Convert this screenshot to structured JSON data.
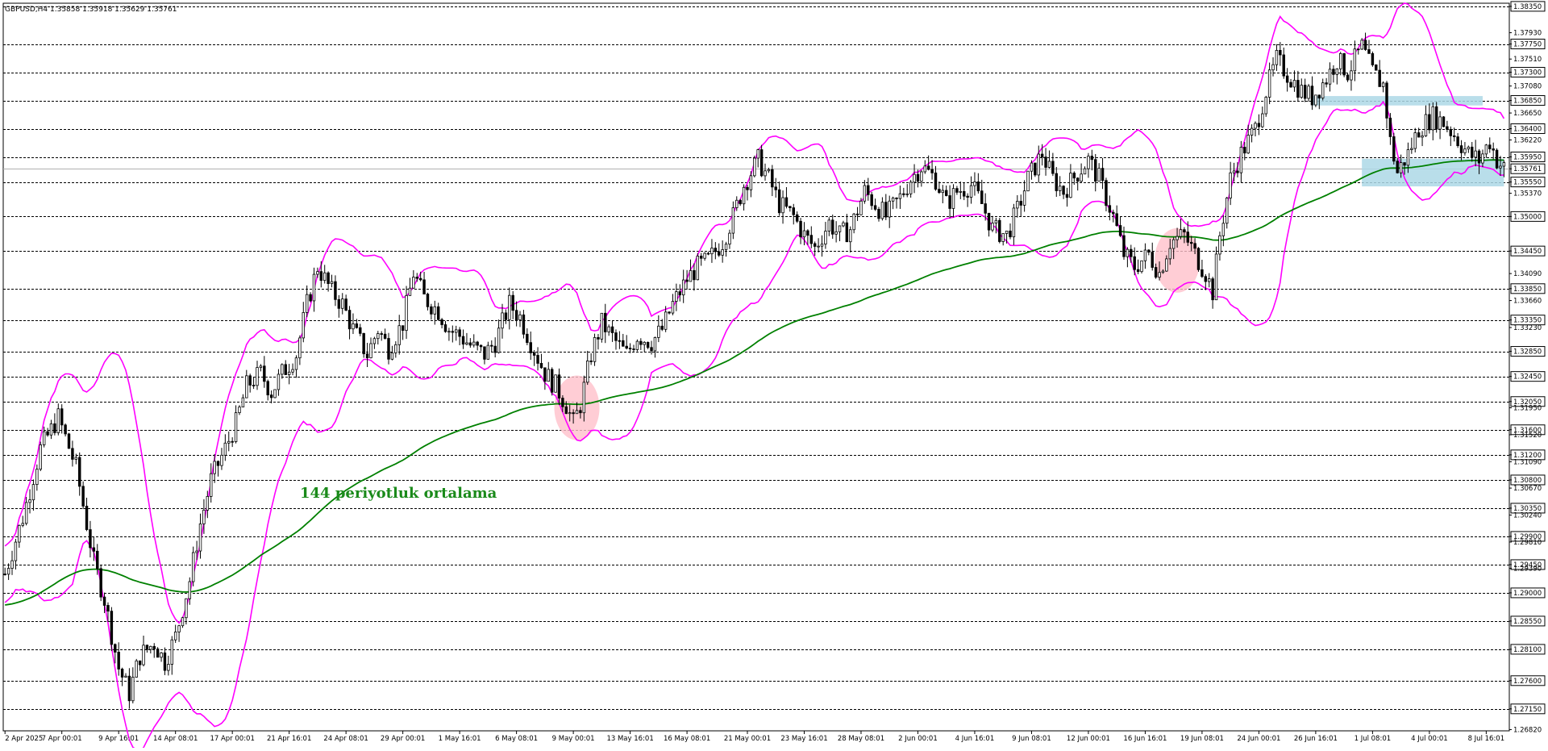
{
  "header": {
    "symbol_line": "GBPUSD,H4  1.35858 1.35918 1.35629 1.35761"
  },
  "annotation": {
    "ma_label": "144 periyotluk ortalama"
  },
  "colors": {
    "candle": "#000000",
    "bollinger": "#ff00ff",
    "moving_average": "#008000",
    "zone_fill": "#add8e6",
    "circle_fill": "#ffc0cb",
    "grid": "#000000"
  },
  "chart_data": {
    "type": "candlestick",
    "title": "GBPUSD,H4",
    "ohlc_header": {
      "open": 1.35858,
      "high": 1.35918,
      "low": 1.35629,
      "close": 1.35761
    },
    "ylim": [
      1.268,
      1.384
    ],
    "x_tick_labels": [
      "2 Apr 2025",
      "7 Apr 00:01",
      "9 Apr 16:01",
      "14 Apr 08:01",
      "17 Apr 00:01",
      "21 Apr 16:01",
      "24 Apr 08:01",
      "29 Apr 00:01",
      "1 May 16:01",
      "6 May 08:01",
      "9 May 00:01",
      "13 May 16:01",
      "16 May 08:01",
      "21 May 00:01",
      "23 May 16:01",
      "28 May 08:01",
      "2 Jun 00:01",
      "4 Jun 16:01",
      "9 Jun 08:01",
      "12 Jun 00:01",
      "16 Jun 16:01",
      "19 Jun 08:01",
      "24 Jun 00:01",
      "26 Jun 16:01",
      "1 Jul 08:01",
      "4 Jul 00:01",
      "8 Jul 16:01"
    ],
    "y_tick_labels": [
      "1.38350",
      "1.37930",
      "1.37750",
      "1.37510",
      "1.37300",
      "1.37080",
      "1.36850",
      "1.36650",
      "1.36400",
      "1.36220",
      "1.35950",
      "1.35761",
      "1.35550",
      "1.35370",
      "1.35000",
      "1.34450",
      "1.34090",
      "1.33850",
      "1.33660",
      "1.33350",
      "1.33230",
      "1.32850",
      "1.32450",
      "1.32050",
      "1.31950",
      "1.31600",
      "1.31520",
      "1.31200",
      "1.31090",
      "1.30800",
      "1.30670",
      "1.30350",
      "1.30240",
      "1.29900",
      "1.29810",
      "1.29450",
      "1.29390",
      "1.29000",
      "1.28550",
      "1.28100",
      "1.27600",
      "1.27150",
      "1.26820"
    ],
    "horizontal_levels": [
      1.3835,
      1.3775,
      1.373,
      1.3685,
      1.364,
      1.3595,
      1.3555,
      1.35,
      1.3445,
      1.3385,
      1.3335,
      1.3285,
      1.3245,
      1.3205,
      1.316,
      1.312,
      1.308,
      1.3035,
      1.299,
      1.2945,
      1.29,
      1.2855,
      1.281,
      1.276,
      1.2715
    ],
    "current_price": 1.35761,
    "price_path": [
      [
        0,
        1.293
      ],
      [
        5,
        1.302
      ],
      [
        10,
        1.313
      ],
      [
        15,
        1.318
      ],
      [
        20,
        1.31
      ],
      [
        25,
        1.295
      ],
      [
        28,
        1.289
      ],
      [
        32,
        1.278
      ],
      [
        35,
        1.274
      ],
      [
        38,
        1.28
      ],
      [
        42,
        1.282
      ],
      [
        45,
        1.279
      ],
      [
        48,
        1.283
      ],
      [
        52,
        1.292
      ],
      [
        55,
        1.301
      ],
      [
        58,
        1.308
      ],
      [
        62,
        1.313
      ],
      [
        65,
        1.317
      ],
      [
        68,
        1.323
      ],
      [
        72,
        1.325
      ],
      [
        75,
        1.322
      ],
      [
        78,
        1.325
      ],
      [
        82,
        1.328
      ],
      [
        85,
        1.336
      ],
      [
        88,
        1.342
      ],
      [
        92,
        1.338
      ],
      [
        95,
        1.336
      ],
      [
        98,
        1.332
      ],
      [
        102,
        1.328
      ],
      [
        105,
        1.332
      ],
      [
        108,
        1.329
      ],
      [
        112,
        1.333
      ],
      [
        115,
        1.341
      ],
      [
        118,
        1.337
      ],
      [
        122,
        1.335
      ],
      [
        125,
        1.332
      ],
      [
        128,
        1.331
      ],
      [
        132,
        1.329
      ],
      [
        135,
        1.328
      ],
      [
        138,
        1.33
      ],
      [
        142,
        1.336
      ],
      [
        145,
        1.334
      ],
      [
        148,
        1.33
      ],
      [
        152,
        1.325
      ],
      [
        155,
        1.323
      ],
      [
        158,
        1.32
      ],
      [
        160,
        1.317
      ],
      [
        162,
        1.32
      ],
      [
        165,
        1.328
      ],
      [
        168,
        1.333
      ],
      [
        172,
        1.33
      ],
      [
        175,
        1.328
      ],
      [
        178,
        1.331
      ],
      [
        182,
        1.33
      ],
      [
        185,
        1.332
      ],
      [
        188,
        1.336
      ],
      [
        192,
        1.34
      ],
      [
        195,
        1.342
      ],
      [
        198,
        1.343
      ],
      [
        202,
        1.346
      ],
      [
        205,
        1.35
      ],
      [
        208,
        1.355
      ],
      [
        212,
        1.359
      ],
      [
        215,
        1.356
      ],
      [
        218,
        1.352
      ],
      [
        222,
        1.35
      ],
      [
        225,
        1.347
      ],
      [
        228,
        1.345
      ],
      [
        232,
        1.349
      ],
      [
        235,
        1.347
      ],
      [
        238,
        1.348
      ],
      [
        242,
        1.354
      ],
      [
        245,
        1.352
      ],
      [
        248,
        1.35
      ],
      [
        252,
        1.353
      ],
      [
        255,
        1.356
      ],
      [
        258,
        1.358
      ],
      [
        262,
        1.356
      ],
      [
        265,
        1.352
      ],
      [
        268,
        1.354
      ],
      [
        272,
        1.355
      ],
      [
        275,
        1.352
      ],
      [
        278,
        1.348
      ],
      [
        282,
        1.347
      ],
      [
        285,
        1.351
      ],
      [
        288,
        1.356
      ],
      [
        292,
        1.36
      ],
      [
        295,
        1.356
      ],
      [
        298,
        1.354
      ],
      [
        302,
        1.357
      ],
      [
        305,
        1.359
      ],
      [
        308,
        1.356
      ],
      [
        312,
        1.35
      ],
      [
        315,
        1.344
      ],
      [
        318,
        1.342
      ],
      [
        322,
        1.344
      ],
      [
        325,
        1.341
      ],
      [
        328,
        1.346
      ],
      [
        332,
        1.347
      ],
      [
        335,
        1.344
      ],
      [
        338,
        1.341
      ],
      [
        340,
        1.338
      ],
      [
        342,
        1.347
      ],
      [
        345,
        1.356
      ],
      [
        348,
        1.36
      ],
      [
        352,
        1.364
      ],
      [
        355,
        1.37
      ],
      [
        358,
        1.375
      ],
      [
        362,
        1.372
      ],
      [
        365,
        1.37
      ],
      [
        368,
        1.369
      ],
      [
        372,
        1.372
      ],
      [
        375,
        1.375
      ],
      [
        378,
        1.373
      ],
      [
        382,
        1.377
      ],
      [
        385,
        1.373
      ],
      [
        388,
        1.371
      ],
      [
        390,
        1.362
      ],
      [
        392,
        1.357
      ],
      [
        395,
        1.36
      ],
      [
        398,
        1.364
      ],
      [
        402,
        1.366
      ],
      [
        405,
        1.365
      ],
      [
        408,
        1.363
      ],
      [
        412,
        1.36
      ],
      [
        415,
        1.359
      ],
      [
        418,
        1.362
      ],
      [
        420,
        1.359
      ],
      [
        422,
        1.3576
      ]
    ],
    "series": [
      {
        "name": "144 periyotluk ortalama",
        "type": "moving_average"
      },
      {
        "type": "bollinger_upper"
      },
      {
        "type": "bollinger_lower"
      }
    ],
    "zones": [
      {
        "y_low": 1.3677,
        "y_high": 1.3692,
        "x_from": 368,
        "x_to": 416
      },
      {
        "y_low": 1.3548,
        "y_high": 1.3592,
        "x_from": 382,
        "x_to": 422
      }
    ],
    "circles": [
      {
        "x": 161,
        "y": 1.3195
      },
      {
        "x": 330,
        "y": 1.343
      }
    ]
  }
}
